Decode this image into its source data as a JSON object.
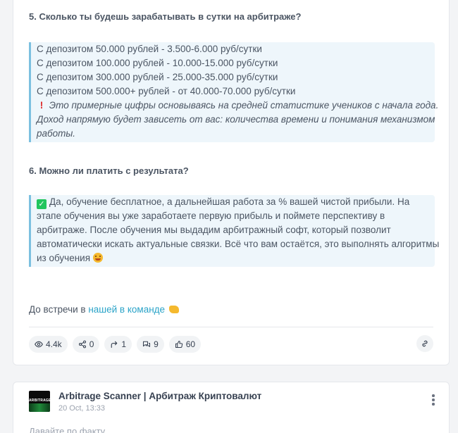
{
  "post": {
    "q5_title": "5. Сколько ты будешь зарабатывать в сутки на арбитраже?",
    "q5_lines": [
      "С депозитом 50.000 рублей - 3.500-6.000 руб/сутки",
      "С депозитом 100.000 рублей - 10.000-15.000 руб/сутки",
      "С депозитом 300.000 рублей - 25.000-35.000 руб/сутки",
      "С депозитом 500.000+ рублей - от 40.000-70.000 руб/сутки"
    ],
    "q5_note_lines": [
      "Это примерные цифры основываясь на средней статистике учеников с начала года.",
      "Доход напрямую будет зависеть от вас: количества времени и понимания механизмом",
      "работы."
    ],
    "q6_title": "6. Можно ли платить с результата?",
    "q6_lines": [
      "Да, обучение бесплатное, а дальнейшая работа за % вашей чистой прибыли. На",
      "этапе обучения вы уже заработаете первую прибыль и поймете перспективу в",
      "арбитраже. После обучения мы выдадим арбитражный софт, который позволит",
      "автоматически искать актуальные связки. Всё что вам остаётся, это выполнять алгоритмы",
      "из обучения"
    ],
    "footer_prefix": "До встречи в ",
    "footer_link": "нашей в команде",
    "stats": {
      "views": "4.4k",
      "shares": "0",
      "forwards": "1",
      "comments": "9",
      "likes": "60"
    }
  },
  "next_post": {
    "channel_name": "Arbitrage Scanner | Арбитраж Криптовалют",
    "time": "20 Oct, 13:33",
    "avatar_text": "ARBITRAGE",
    "preview": "Давайте по факту"
  },
  "colors": {
    "accent_link": "#2aa3c8",
    "quote_bg": "#eef6fb",
    "quote_border": "#7cc0e0"
  }
}
